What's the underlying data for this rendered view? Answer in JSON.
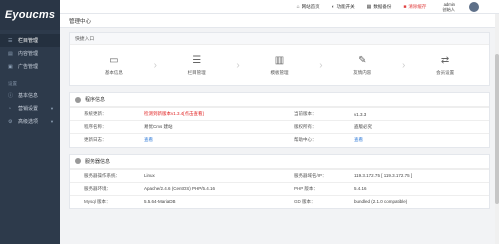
{
  "brand": {
    "logo": "Eyoucms"
  },
  "sidebar": {
    "items": [
      {
        "label": "栏目管理",
        "icon": "list-icon"
      },
      {
        "label": "内容管理",
        "icon": "document-icon"
      },
      {
        "label": "广告管理",
        "icon": "image-icon"
      }
    ],
    "section_label": "设置",
    "settings_items": [
      {
        "label": "基本信息",
        "icon": "info-icon"
      },
      {
        "label": "营销设置",
        "icon": "chart-icon"
      },
      {
        "label": "高级选项",
        "icon": "gear-icon"
      }
    ]
  },
  "topbar": {
    "items": [
      {
        "label": "网站首页",
        "icon": "home-icon"
      },
      {
        "label": "功能开关",
        "icon": "toggle-icon"
      },
      {
        "label": "数据备份",
        "icon": "database-icon"
      },
      {
        "label": "清除缓存",
        "icon": "trash-icon"
      }
    ],
    "admin_name": "admin",
    "admin_role": "创始人"
  },
  "page_title": "管理中心",
  "quick": {
    "title": "快捷入口",
    "items": [
      {
        "label": "基本信息",
        "icon": "id-card-icon"
      },
      {
        "label": "栏目管理",
        "icon": "list-icon"
      },
      {
        "label": "模板管理",
        "icon": "template-icon"
      },
      {
        "label": "友情内容",
        "icon": "link-icon"
      },
      {
        "label": "会员设置",
        "icon": "share-icon"
      }
    ]
  },
  "program_info": {
    "title": "程序信息",
    "rows": [
      {
        "l1": "系统更新：",
        "v1": "检测到新版本v1.3.4[点击查看]",
        "l2": "当前版本：",
        "v2": "v1.3.3"
      },
      {
        "l1": "程序名称：",
        "v1": "易优Cms 建站",
        "l2": "版权所有：",
        "v2": "盗版必究"
      },
      {
        "l1": "更新日志：",
        "v1": "查看",
        "l2": "帮助中心：",
        "v2": "查看"
      }
    ]
  },
  "server_info": {
    "title": "服务器信息",
    "rows": [
      {
        "l1": "服务器操作系统：",
        "v1": "Linux",
        "l2": "服务器域名/IP：",
        "v2": "119.3.172.75 [ 119.3.172.75 ]"
      },
      {
        "l1": "服务器环境：",
        "v1": "Apache/2.4.6 (CentOS) PHP/5.4.16",
        "l2": "PHP 版本：",
        "v2": "5.4.16"
      },
      {
        "l1": "Mysql 版本：",
        "v1": "5.5.64-MariaDB",
        "l2": "GD 版本：",
        "v2": "bundled (2.1.0 compatible)"
      }
    ]
  }
}
